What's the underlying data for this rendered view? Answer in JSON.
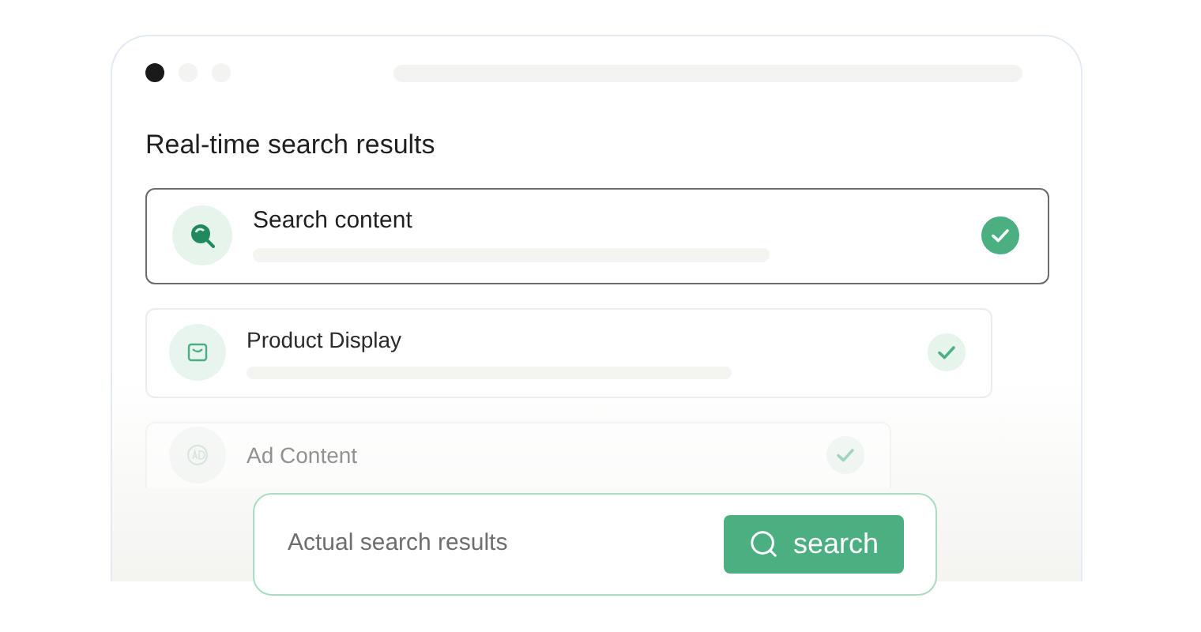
{
  "window": {
    "dots": [
      {
        "selected": true
      },
      {
        "selected": false
      },
      {
        "selected": false
      }
    ]
  },
  "title": "Real-time search results",
  "results": [
    {
      "kind": "search",
      "title": "Search content",
      "selected": true
    },
    {
      "kind": "product",
      "title": "Product Display",
      "selected": false
    },
    {
      "kind": "ad",
      "title": "Ad Content",
      "selected": false
    }
  ],
  "search": {
    "placeholder": "Actual search results",
    "button": "search"
  }
}
